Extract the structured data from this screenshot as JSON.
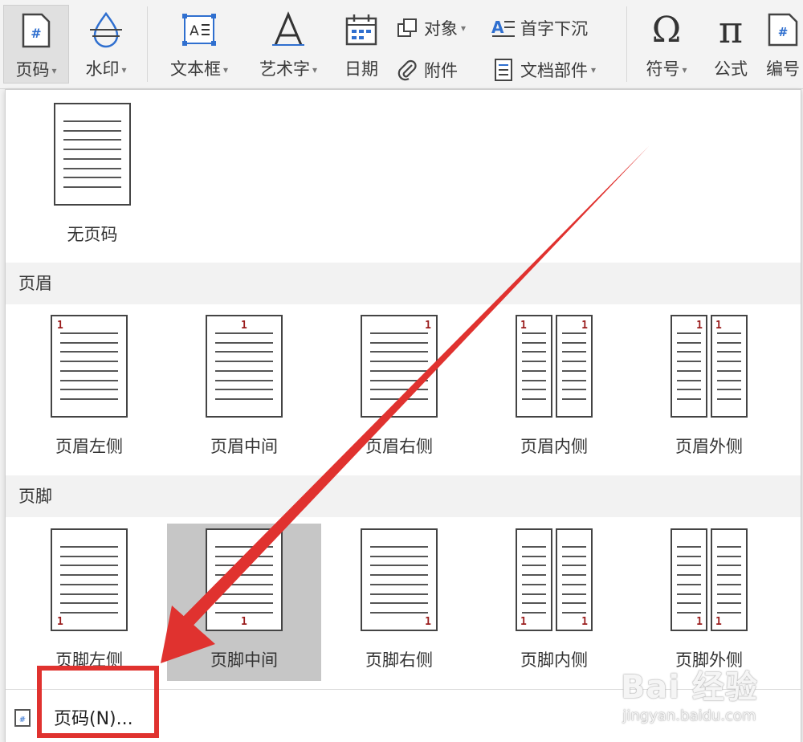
{
  "toolbar": {
    "page_number": "页码",
    "watermark": "水印",
    "text_box": "文本框",
    "word_art": "艺术字",
    "date": "日期",
    "object": "对象",
    "attachment": "附件",
    "drop_cap": "首字下沉",
    "doc_parts": "文档部件",
    "symbol": "符号",
    "formula": "公式",
    "numbering": "编号"
  },
  "panel": {
    "no_page_number": "无页码",
    "header_section": "页眉",
    "footer_section": "页脚",
    "header_options": [
      "页眉左侧",
      "页眉中间",
      "页眉右侧",
      "页眉内侧",
      "页眉外侧"
    ],
    "footer_options": [
      "页脚左侧",
      "页脚中间",
      "页脚右侧",
      "页脚内侧",
      "页脚外侧"
    ],
    "page_num_marker": "1",
    "page_number_dialog": "页码(N)...",
    "selected_option": "页脚中间"
  },
  "watermark_brand": {
    "line1": "Bai 经验",
    "line2": "jingyan.baidu.com"
  },
  "colors": {
    "annotation_red": "#e0322f",
    "page_number_red": "#9a1c1c",
    "accent_blue": "#2f6fcf"
  }
}
